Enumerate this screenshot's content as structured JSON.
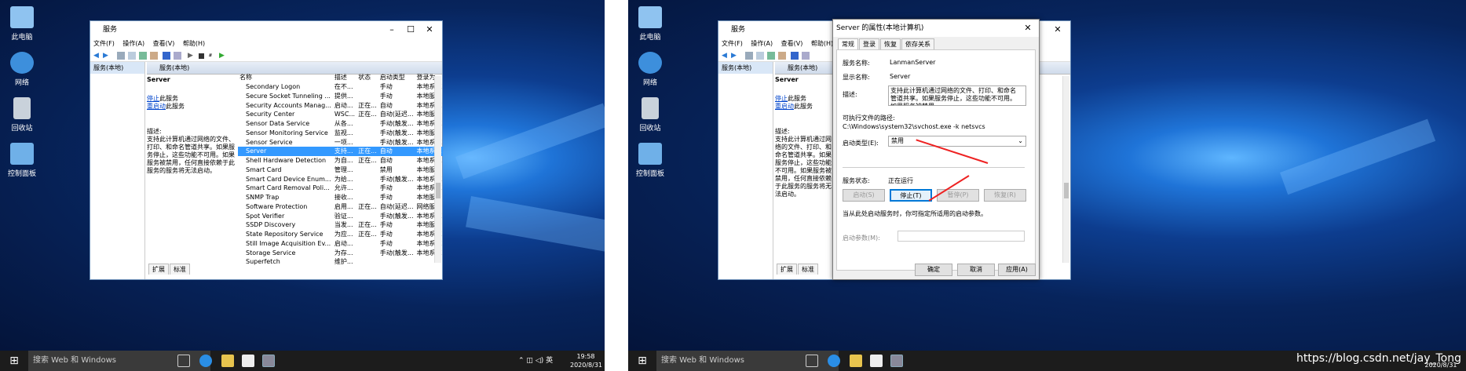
{
  "left": {
    "desktop_icons": [
      "此电脑",
      "网络",
      "回收站",
      "控制面板"
    ],
    "window_title": "服务",
    "menu": [
      "文件(F)",
      "操作(A)",
      "查看(V)",
      "帮助(H)"
    ],
    "tree_item": "服务(本地)",
    "header_title": "服务(本地)",
    "selected_service": "Server",
    "stop_link": "停止",
    "stop_suffix": "此服务",
    "restart_link": "重启动",
    "restart_suffix": "此服务",
    "desc_label": "描述:",
    "desc_text": "支持此计算机通过网络的文件、打印、和命名管道共享。如果服务停止，这些功能不可用。如果服务被禁用，任何直接依赖于此服务的服务将无法启动。",
    "columns": [
      "名称",
      "描述",
      "状态",
      "启动类型",
      "登录为"
    ],
    "rows": [
      {
        "name": "Secondary Logon",
        "desc": "在不...",
        "status": "",
        "startup": "手动",
        "logon": "本地系统"
      },
      {
        "name": "Secure Socket Tunneling ...",
        "desc": "提供...",
        "status": "",
        "startup": "手动",
        "logon": "本地服务"
      },
      {
        "name": "Security Accounts Manag...",
        "desc": "启动...",
        "status": "正在...",
        "startup": "自动",
        "logon": "本地系统"
      },
      {
        "name": "Security Center",
        "desc": "WSC...",
        "status": "正在...",
        "startup": "自动(延迟...",
        "logon": "本地服务"
      },
      {
        "name": "Sensor Data Service",
        "desc": "从各...",
        "status": "",
        "startup": "手动(触发...",
        "logon": "本地系统"
      },
      {
        "name": "Sensor Monitoring Service",
        "desc": "监视...",
        "status": "",
        "startup": "手动(触发...",
        "logon": "本地服务"
      },
      {
        "name": "Sensor Service",
        "desc": "一项...",
        "status": "",
        "startup": "手动(触发...",
        "logon": "本地系统"
      },
      {
        "name": "Server",
        "desc": "支持...",
        "status": "正在...",
        "startup": "自动",
        "logon": "本地系统",
        "selected": true
      },
      {
        "name": "Shell Hardware Detection",
        "desc": "为自...",
        "status": "正在...",
        "startup": "自动",
        "logon": "本地系统"
      },
      {
        "name": "Smart Card",
        "desc": "管理...",
        "status": "",
        "startup": "禁用",
        "logon": "本地服务"
      },
      {
        "name": "Smart Card Device Enum...",
        "desc": "为给...",
        "status": "",
        "startup": "手动(触发...",
        "logon": "本地系统"
      },
      {
        "name": "Smart Card Removal Poli...",
        "desc": "允许...",
        "status": "",
        "startup": "手动",
        "logon": "本地系统"
      },
      {
        "name": "SNMP Trap",
        "desc": "接收...",
        "status": "",
        "startup": "手动",
        "logon": "本地服务"
      },
      {
        "name": "Software Protection",
        "desc": "启用...",
        "status": "正在...",
        "startup": "自动(延迟...",
        "logon": "网络服务"
      },
      {
        "name": "Spot Verifier",
        "desc": "验证...",
        "status": "",
        "startup": "手动(触发...",
        "logon": "本地系统"
      },
      {
        "name": "SSDP Discovery",
        "desc": "当发...",
        "status": "正在...",
        "startup": "手动",
        "logon": "本地服务"
      },
      {
        "name": "State Repository Service",
        "desc": "为应...",
        "status": "正在...",
        "startup": "手动",
        "logon": "本地系统"
      },
      {
        "name": "Still Image Acquisition Ev...",
        "desc": "启动...",
        "status": "",
        "startup": "手动",
        "logon": "本地系统"
      },
      {
        "name": "Storage Service",
        "desc": "为存...",
        "status": "",
        "startup": "手动(触发...",
        "logon": "本地系统"
      },
      {
        "name": "Superfetch",
        "desc": "维护...",
        "status": "",
        "startup": "",
        "logon": ""
      }
    ],
    "bottom_tabs": [
      "扩展",
      "标准"
    ],
    "search_placeholder": "搜索 Web 和 Windows",
    "time": "19:58",
    "date": "2020/8/31",
    "ime": "英"
  },
  "right": {
    "desktop_icons": [
      "此电脑",
      "网络",
      "回收站",
      "控制面板"
    ],
    "bg_window_title": "服务",
    "bg_menu": [
      "文件(F)",
      "操作(A)",
      "查看(V)",
      "帮助(H)"
    ],
    "bg_tree_item": "服务(本地)",
    "bg_header_title": "服务(本地)",
    "bg_selected_service": "Server",
    "bg_stop_link": "停止",
    "bg_stop_suffix": "此服务",
    "bg_restart_link": "重启动",
    "bg_restart_suffix": "此服务",
    "bg_desc_label": "描述:",
    "bg_desc_text": "支持此计算机通过网络的文件、打印、和命名管道共享。如果服务停止，这些功能不可用。如果服务被禁用，任何直接依赖于此服务的服务将无法启动。",
    "bg_bottom_tabs": [
      "扩展",
      "标准"
    ],
    "dialog_title": "Server 的属性(本地计算机)",
    "dialog_tabs": [
      "常规",
      "登录",
      "恢复",
      "依存关系"
    ],
    "service_name_label": "服务名称:",
    "service_name": "LanmanServer",
    "display_name_label": "显示名称:",
    "display_name": "Server",
    "description_label": "描述:",
    "description": "支持此计算机通过网络的文件、打印、和命名管道共享。如果服务停止，这些功能不可用。如果服务被禁用，",
    "exe_path_label": "可执行文件的路径:",
    "exe_path": "C:\\Windows\\system32\\svchost.exe -k netsvcs",
    "startup_type_label": "启动类型(E):",
    "startup_type": "禁用",
    "status_label": "服务状态:",
    "status_value": "正在运行",
    "btn_start": "启动(S)",
    "btn_stop": "停止(T)",
    "btn_pause": "暂停(P)",
    "btn_resume": "恢复(R)",
    "start_hint": "当从此处启动服务时，你可指定所适用的启动参数。",
    "start_params_label": "启动参数(M):",
    "btn_ok": "确定",
    "btn_cancel": "取消",
    "btn_apply": "应用(A)",
    "search_placeholder": "搜索 Web 和 Windows",
    "date": "2020/8/31",
    "watermark": "https://blog.csdn.net/jay_Tong"
  },
  "colors": {
    "selection": "#3399ff",
    "arrow": "#e22222",
    "taskbar": "#1c1c1c",
    "link": "#0044cc"
  }
}
